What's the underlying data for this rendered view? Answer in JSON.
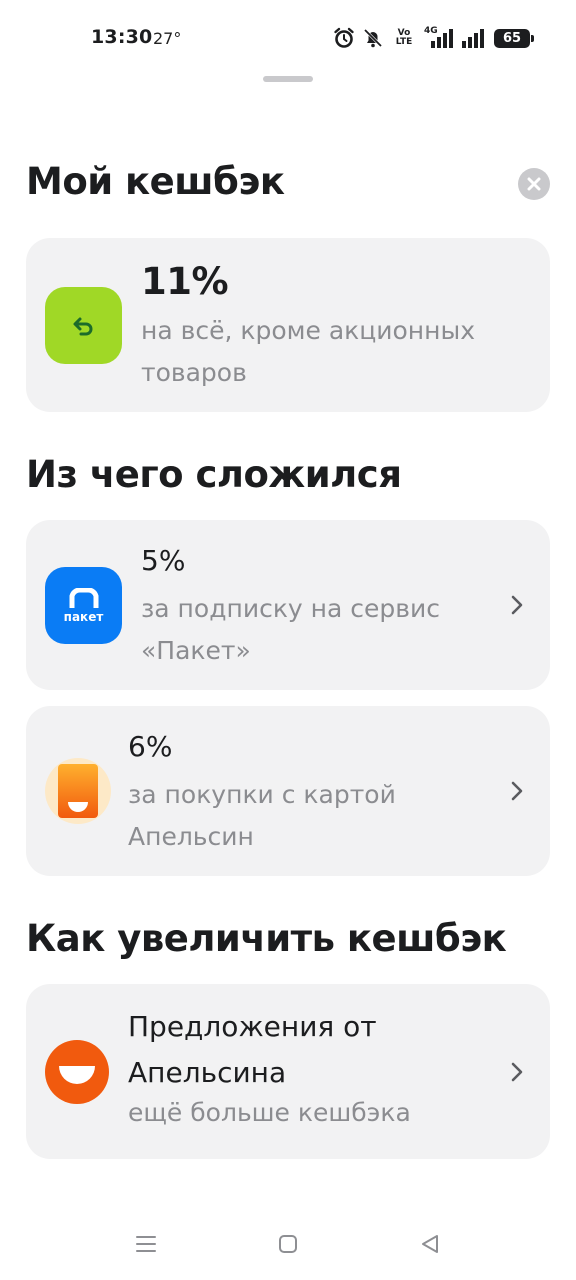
{
  "status_bar": {
    "time": "13:30",
    "temperature": "27°",
    "volte_top": "Vo",
    "volte_bottom": "LTE",
    "network": "4G",
    "battery": "65",
    "icons": [
      "alarm-icon",
      "mute-bell-icon",
      "volte-icon",
      "signal-4g-icon",
      "signal-icon",
      "battery-icon"
    ]
  },
  "header": {
    "title": "Мой кешбэк"
  },
  "main_card": {
    "value": "11%",
    "description": "на всё, кроме акционных товаров",
    "icon": "cashback-return-icon",
    "icon_color": "#a0d826"
  },
  "composition": {
    "title": "Из чего сложился",
    "items": [
      {
        "percent": "5%",
        "description": "за подписку на сервис «Пакет»",
        "icon_label": "пакет",
        "icon_color": "#0a7cf5"
      },
      {
        "percent": "6%",
        "description": "за покупки с картой Апельсин",
        "icon": "apelsin-card-icon",
        "icon_color": "#f7861c"
      }
    ]
  },
  "increase": {
    "title": "Как увеличить кешбэк",
    "offer": {
      "title": "Предложения от Апельсина",
      "description": "ещё больше кешбэка",
      "icon": "apelsin-smile-icon",
      "icon_color": "#f15a0e"
    }
  },
  "colors": {
    "card_background": "#f2f2f3",
    "text_primary": "#1c1d1f",
    "text_secondary": "#8b8c90",
    "close_button": "#c9c9cc"
  }
}
